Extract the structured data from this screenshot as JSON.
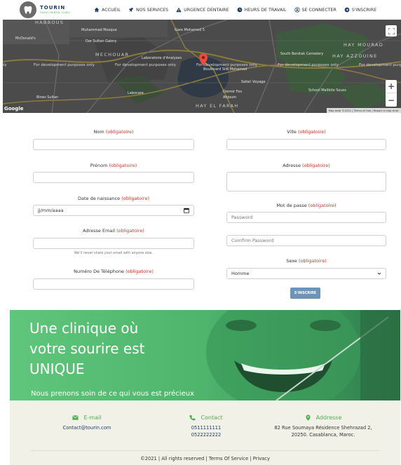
{
  "brand": {
    "name": "TOURIN",
    "tagline": "FAMILY DENTAL CLINIC"
  },
  "nav": [
    {
      "label": "ACCUEIL",
      "icon": "home-icon"
    },
    {
      "label": "NOS SERVICES",
      "icon": "pin-icon"
    },
    {
      "label": "URGENCE DENTAIRE",
      "icon": "warning-icon"
    },
    {
      "label": "HEURS DE TRAVAIL",
      "icon": "clock-icon"
    },
    {
      "label": "SE CONNECTER",
      "icon": "user-icon"
    },
    {
      "label": "S'INSCRIRE",
      "icon": "arrow-circle-icon"
    }
  ],
  "map": {
    "dev_notice": "For development purposes only",
    "labels": [
      "HABBOUS",
      "Muhammad Mosque",
      "Gare Mohamed 5",
      "McDonald's",
      "Dar Sultan Galery",
      "MECHOUAR",
      "Laboratoire d'Analyses",
      "Boulevard Sidi Mohamed",
      "Safari Voyage",
      "Dormir Fes",
      "Ahjoum",
      "Bines Sultan",
      "Labocare",
      "HAY EL FARAH",
      "South Benitak Cemetery",
      "HAY AZZOUINE",
      "HAY MOURAD",
      "School Malikite Souss"
    ],
    "attribution": "Map data ©2021",
    "terms": "Terms of Use",
    "report": "Report a map error",
    "google": "Google",
    "zoom_in": "+",
    "zoom_out": "−"
  },
  "form": {
    "required_text": "(obligatoire)",
    "nom_label": "Nom",
    "prenom_label": "Prénom",
    "naissance_label": "Date de naissance",
    "naissance_placeholder": "jj/mm/aaaa",
    "email_label": "Adresse Email",
    "email_hint": "We'll never share your email with anyone else.",
    "tel_label": "Numéro De Téléphone",
    "ville_label": "Ville",
    "adresse_label": "Adresse",
    "password_label": "Mot de passe",
    "password_placeholder": "Password",
    "confirm_placeholder": "Comfirm Password",
    "sexe_label": "Sexe",
    "sexe_value": "Homme",
    "submit_label": "S'INSCRIRE"
  },
  "hero": {
    "title_lines": [
      "Une clinique où",
      "votre sourire est",
      "UNIQUE"
    ],
    "subtitle": "Nous prenons soin de ce qui vous est précieux"
  },
  "footer": {
    "email_head": "E-mail",
    "email_value": "Contact@tourin.com",
    "contact_head": "Contact",
    "phones": [
      "0511111111",
      "0522222222"
    ],
    "address_head": "Addresse",
    "address_lines": [
      "82 Rue Soumaya Résidence Shehrazad 2,",
      "20250. Casablanca, Maroc."
    ],
    "copyright": "©2021 | All rights reserved | Terms Of Service | Privacy"
  },
  "colors": {
    "green": "#4caf50",
    "hero_green": "#5ac378",
    "navy": "#1c3b6e",
    "required": "#c0392b",
    "button": "#6e93b8"
  }
}
